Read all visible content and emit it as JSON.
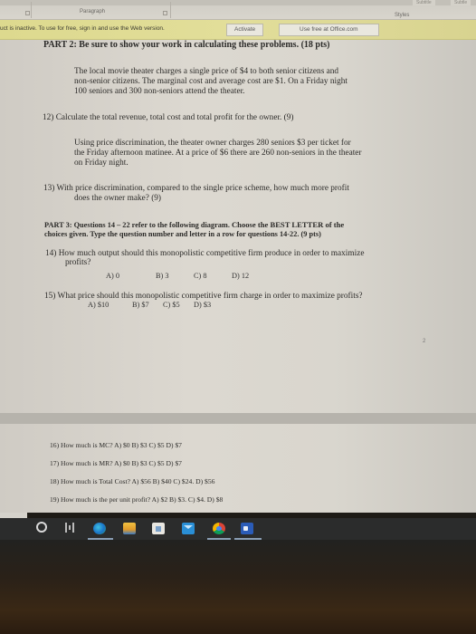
{
  "ribbon": {
    "paragraph_label": "Paragraph",
    "styles_label": "Styles",
    "style_boxes": [
      "Subtitle",
      "Subtle"
    ]
  },
  "notice": {
    "message": "uct is inactive. To use for free, sign in and use the Web version.",
    "activate_label": "Activate",
    "use_free_label": "Use free at Office.com"
  },
  "document": {
    "part2_heading": "PART 2: Be sure to show your work in calculating these problems. (18 pts)",
    "scenario1": [
      "The local movie theater charges a single price of $4 to both senior citizens and",
      "non-senior citizens. The marginal cost and average cost are $1. On a Friday night",
      "100 seniors and 300 non-seniors attend the theater."
    ],
    "q12": "12) Calculate the total revenue, total cost and total profit for the owner. (9)",
    "scenario2": [
      "Using price discrimination, the theater owner charges 280 seniors $3 per ticket for",
      "the Friday afternoon matinee. At a price of $6 there are 260 non-seniors in the theater",
      "on Friday night."
    ],
    "q13": [
      "13) With price discrimination, compared to the single price scheme, how much more profit",
      "does the owner make? (9)"
    ],
    "part3_line1_a": "PART 3: Questions 14 – 22 refer to the following diagram. ",
    "part3_line1_b": "Choose the BEST LETTER of the",
    "part3_line2": "choices given. Type the question number and letter in a row for questions 14-22. (9 pts)",
    "q14": {
      "text": [
        "14)  How much output should this monopolistic competitive firm produce in order to maximize",
        "profits?"
      ],
      "options": [
        "A)  0",
        "B)  3",
        "C)  8",
        "D)  12"
      ]
    },
    "q15": {
      "text": "15) What price should this monopolistic competitive firm charge in order to maximize profits?",
      "options": [
        "A)   $10",
        "B)  $7",
        "C)  $5",
        "D)  $3"
      ]
    },
    "page_number": "2",
    "q16": "16) How much is MC?   A) $0   B) $3   C) $5   D) $7",
    "q17": "17) How much is MR?   A) $0   B) $3   C) $5   D) $7",
    "q18": "18) How much is Total Cost?   A) $56   B) $40   C) $24.   D) $56",
    "q19": "19) How much is the per unit profit?   A) $2  B) $3.   C) $4.   D) $8"
  },
  "taskbar": {
    "icons": [
      "cortana-search",
      "task-view",
      "edge",
      "file-explorer",
      "store",
      "mail",
      "chrome",
      "word"
    ]
  }
}
